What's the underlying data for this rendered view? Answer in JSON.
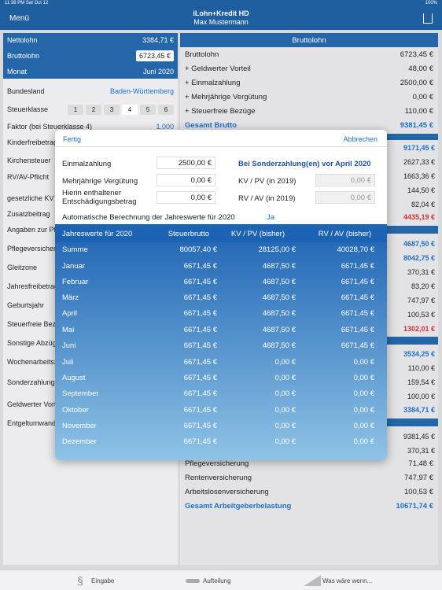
{
  "status": {
    "time": "11:38 PM  Sat Oct 12",
    "battery": "100%"
  },
  "header": {
    "menu": "Menü",
    "title": "iLohn+Kredit HD",
    "user": "Max Mustermann"
  },
  "left": {
    "rows": [
      {
        "label": "Nettolohn",
        "value": "3384,71 €"
      },
      {
        "label": "Bruttolohn",
        "value": "6723,45 €"
      },
      {
        "label": "Monat",
        "value": "Juni 2020"
      },
      {
        "label": "Bundesland",
        "value": "Baden-Württemberg"
      },
      {
        "label": "Steuerklasse",
        "value": ""
      },
      {
        "label": "Faktor (bei Steuerklasse 4)",
        "value": "1,000"
      },
      {
        "label": "Kinderfreibetrag",
        "value": ""
      },
      {
        "label": "Kirchensteuer",
        "value": ""
      },
      {
        "label": "RV/AV-Pflicht",
        "value": ""
      },
      {
        "label": "gesetzliche KV",
        "value": ""
      },
      {
        "label": "Zusatzbeitrag",
        "value": ""
      },
      {
        "label": "Angaben zur Pflegeversicher",
        "value": ""
      },
      {
        "label": "Pflegeversicherung",
        "value": ""
      },
      {
        "label": "Gleitzone",
        "value": ""
      },
      {
        "label": "Jahresfreibetrag",
        "value": ""
      },
      {
        "label": "Geburtsjahr",
        "value": ""
      },
      {
        "label": "Steuerfreie Bezüge",
        "value": ""
      },
      {
        "label": "Sonstige Abzüge",
        "value": ""
      },
      {
        "label": "Wochenarbeitszeit",
        "value": ""
      },
      {
        "label": "Sonderzahlung",
        "value": ""
      },
      {
        "label": "Geldwerter Vorteil",
        "value": ""
      },
      {
        "label": "Entgeltumwandlung",
        "value": ""
      }
    ],
    "steuerklassen": [
      "1",
      "2",
      "3",
      "4",
      "5",
      "6"
    ],
    "selected_klasse": "4"
  },
  "right": {
    "header": "Bruttolohn",
    "rows": [
      {
        "label": "Bruttolohn",
        "value": "6723,45 €"
      },
      {
        "label": "+ Geldwerter Vorteil",
        "value": "48,00 €"
      },
      {
        "label": "+ Einmalzahlung",
        "value": "2500,00 €"
      },
      {
        "label": "+ Mehrjährige Vergütung",
        "value": "0,00 €"
      },
      {
        "label": "+ Steuerfreie Bezüge",
        "value": "110,00 €"
      },
      {
        "label": "Gesamt Brutto",
        "value": "9381,45 €"
      }
    ],
    "side_values": [
      "9171,45 €",
      "2627,33 €",
      "1663,36 €",
      "144,50 €",
      "82,04 €",
      "4435,19 €",
      "4687,50 €",
      "8042,75 €",
      "370,31 €",
      "83,20 €",
      "747,97 €",
      "100,53 €",
      "1302,01 €",
      "3534,25 €",
      "110,00 €",
      "159,54 €",
      "100,00 €",
      "3384,71 €",
      "9381,45 €",
      "370,31 €"
    ],
    "bottom_rows": [
      {
        "label": "Pflegeversicherung",
        "value": "71,48 €"
      },
      {
        "label": "Rentenversicherung",
        "value": "747,97 €"
      },
      {
        "label": "Arbeitslosenversicherung",
        "value": "100,53 €"
      },
      {
        "label": "Gesamt Arbeitgeberbelastung",
        "value": "10671,74 €"
      }
    ]
  },
  "modal": {
    "done": "Fertig",
    "cancel": "Abbrechen",
    "einmal_label": "Einmalzahlung",
    "einmal_value": "2500,00 €",
    "sonder_title": "Bei Sonderzahlung(en) vor April 2020",
    "mehr_label": "Mehrjährige Vergütung",
    "mehr_value": "0,00 €",
    "kvpv_label": "KV / PV (in 2019)",
    "kvpv_value": "0,00 €",
    "hierin_label1": "Hierin enthaltener",
    "hierin_label2": "Entschädigungsbetrag",
    "hierin_value": "0,00 €",
    "rvav_label": "RV / AV (in 2019)",
    "rvav_value": "0,00 €",
    "auto_label": "Automatische Berechnung der Jahreswerte für 2020",
    "auto_value": "Ja",
    "table": {
      "headers": [
        "Jahreswerte für 2020",
        "Steuerbrutto",
        "KV / PV (bisher)",
        "RV / AV (bisher)"
      ],
      "rows": [
        [
          "Summe",
          "80057,40 €",
          "28125,00 €",
          "40028,70 €"
        ],
        [
          "Januar",
          "6671,45 €",
          "4687,50 €",
          "6671,45 €"
        ],
        [
          "Februar",
          "6671,45 €",
          "4687,50 €",
          "6671,45 €"
        ],
        [
          "März",
          "6671,45 €",
          "4687,50 €",
          "6671,45 €"
        ],
        [
          "April",
          "6671,45 €",
          "4687,50 €",
          "6671,45 €"
        ],
        [
          "Mai",
          "6671,45 €",
          "4687,50 €",
          "6671,45 €"
        ],
        [
          "Juni",
          "6671,45 €",
          "4687,50 €",
          "6671,45 €"
        ],
        [
          "Juli",
          "6671,45 €",
          "0,00 €",
          "0,00 €"
        ],
        [
          "August",
          "6671,45 €",
          "0,00 €",
          "0,00 €"
        ],
        [
          "September",
          "6671,45 €",
          "0,00 €",
          "0,00 €"
        ],
        [
          "Oktober",
          "6671,45 €",
          "0,00 €",
          "0,00 €"
        ],
        [
          "November",
          "6671,45 €",
          "0,00 €",
          "0,00 €"
        ],
        [
          "Dezember",
          "6671,45 €",
          "0,00 €",
          "0,00 €"
        ]
      ]
    }
  },
  "tabs": {
    "eingabe": "Eingabe",
    "aufteilung": "Aufteilung",
    "waswaere": "Was wäre wenn..."
  }
}
